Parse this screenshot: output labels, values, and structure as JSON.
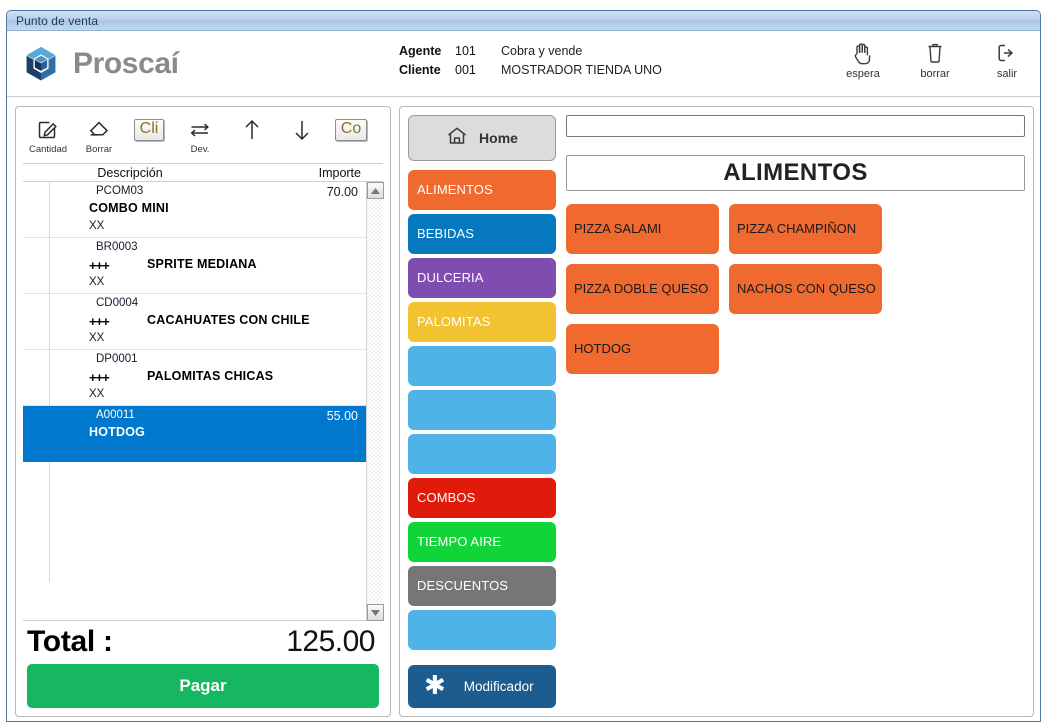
{
  "window": {
    "title": "Punto de venta"
  },
  "brand": {
    "name": "Proscaí",
    "logo_icon": "proscai-cube-logo"
  },
  "header": {
    "agente_label": "Agente",
    "agente_number": "101",
    "agente_role": "Cobra y vende",
    "cliente_label": "Cliente",
    "cliente_number": "001",
    "cliente_name": "MOSTRADOR TIENDA UNO",
    "actions": [
      {
        "label": "espera",
        "icon": "hand-icon"
      },
      {
        "label": "borrar",
        "icon": "trash-icon"
      },
      {
        "label": "salir",
        "icon": "exit-icon"
      }
    ]
  },
  "toolbar": {
    "items": [
      {
        "label": "Cantidad",
        "icon": "edit-pencil-icon",
        "type": "icon"
      },
      {
        "label": "Borrar",
        "icon": "eraser-icon",
        "type": "icon"
      },
      {
        "label": "",
        "icon": "cli-button",
        "type": "button",
        "text": "Cli"
      },
      {
        "label": "Dev.",
        "icon": "swap-arrows-icon",
        "type": "icon"
      },
      {
        "label": "",
        "icon": "arrow-up-icon",
        "type": "icon"
      },
      {
        "label": "",
        "icon": "arrow-down-icon",
        "type": "icon"
      },
      {
        "label": "",
        "icon": "co-button",
        "type": "button",
        "text": "Co"
      }
    ]
  },
  "ticket": {
    "columns": {
      "description": "Descripción",
      "amount": "Importe"
    },
    "rows": [
      {
        "code": "PCOM03",
        "plus": "",
        "name": "COMBO MINI",
        "indent": 0,
        "note": "XX",
        "amount": "70.00",
        "selected": false
      },
      {
        "code": "BR0003",
        "plus": "+++",
        "name": "SPRITE MEDIANA",
        "indent": 1,
        "note": "XX",
        "amount": "",
        "selected": false
      },
      {
        "code": "CD0004",
        "plus": "+++",
        "name": "CACAHUATES CON CHILE",
        "indent": 1,
        "note": "XX",
        "amount": "",
        "selected": false
      },
      {
        "code": "DP0001",
        "plus": "+++",
        "name": "PALOMITAS CHICAS",
        "indent": 1,
        "note": "XX",
        "amount": "",
        "selected": false
      },
      {
        "code": "A00011",
        "plus": "",
        "name": "HOTDOG",
        "indent": 0,
        "note": "",
        "amount": "55.00",
        "selected": true
      }
    ],
    "total_label": "Total :",
    "total_value": "125.00",
    "pay_label": "Pagar",
    "selected_color": "#0078CE"
  },
  "categories": {
    "home_label": "Home",
    "home_icon": "home-icon",
    "items": [
      {
        "label": "ALIMENTOS",
        "color": "#F0692F"
      },
      {
        "label": "BEBIDAS",
        "color": "#0678BE"
      },
      {
        "label": "DULCERIA",
        "color": "#7F4CAF"
      },
      {
        "label": "PALOMITAS",
        "color": "#F2C230"
      },
      {
        "label": "",
        "color": "#4FB3E8"
      },
      {
        "label": "",
        "color": "#4FB3E8"
      },
      {
        "label": "",
        "color": "#4FB3E8"
      },
      {
        "label": "COMBOS",
        "color": "#E01B0C"
      },
      {
        "label": "TIEMPO AIRE",
        "color": "#11D438"
      },
      {
        "label": "DESCUENTOS",
        "color": "#767676"
      },
      {
        "label": "",
        "color": "#4FB3E8"
      }
    ],
    "modificador_label": "Modificador",
    "modificador_icon": "asterisk-icon"
  },
  "main": {
    "search_value": "",
    "search_placeholder": "",
    "active_category": "ALIMENTOS",
    "products": [
      {
        "label": "PIZZA SALAMI",
        "color": "#F0692F"
      },
      {
        "label": "PIZZA CHAMPIÑON",
        "color": "#F0692F"
      },
      {
        "label": "PIZZA DOBLE QUESO",
        "color": "#F0692F"
      },
      {
        "label": "NACHOS CON QUESO",
        "color": "#F0692F"
      },
      {
        "label": "HOTDOG",
        "color": "#F0692F"
      }
    ]
  }
}
